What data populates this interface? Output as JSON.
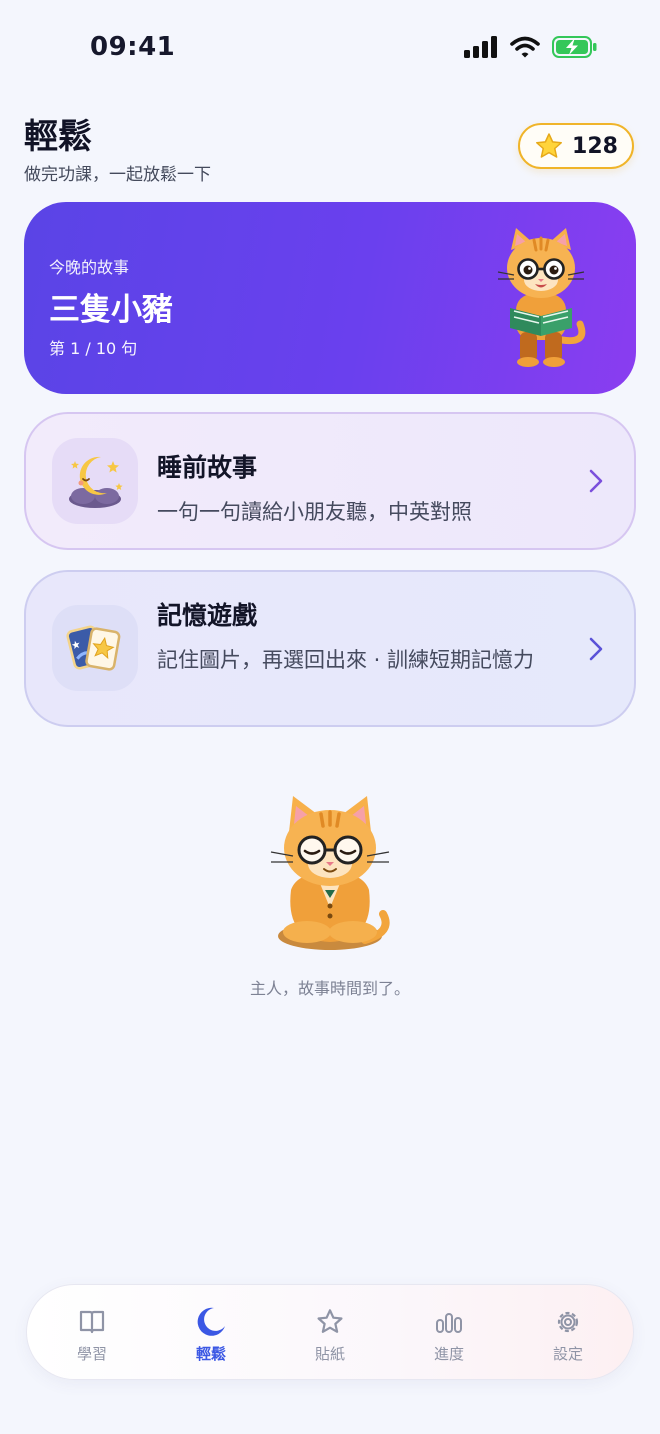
{
  "status_bar": {
    "time": "09:41"
  },
  "header": {
    "title": "輕鬆",
    "subtitle": "做完功課，一起放鬆一下"
  },
  "stars": {
    "count": "128",
    "icon": "star-icon"
  },
  "tonight_story": {
    "kicker": "今晚的故事",
    "title": "三隻小豬",
    "progress": "第 1 / 10 句"
  },
  "activities": [
    {
      "title": "睡前故事",
      "description": "一句一句讀給小朋友聽，中英對照",
      "icon": "moon-icon"
    },
    {
      "title": "記憶遊戲",
      "description": "記住圖片，再選回出來 · 訓練短期記憶力",
      "icon": "memory-cards-icon"
    }
  ],
  "mascot": {
    "caption": "主人，故事時間到了。"
  },
  "tabs": [
    {
      "label": "學習",
      "icon": "book-icon",
      "active": false
    },
    {
      "label": "輕鬆",
      "icon": "moon-icon",
      "active": true
    },
    {
      "label": "貼紙",
      "icon": "star-outline-icon",
      "active": false
    },
    {
      "label": "進度",
      "icon": "bar-chart-icon",
      "active": false
    },
    {
      "label": "設定",
      "icon": "gear-icon",
      "active": false
    }
  ],
  "colors": {
    "accent": "#3b57e4",
    "hero_start": "#5a44e6",
    "hero_end": "#8a3df0",
    "star": "#f0b429"
  }
}
